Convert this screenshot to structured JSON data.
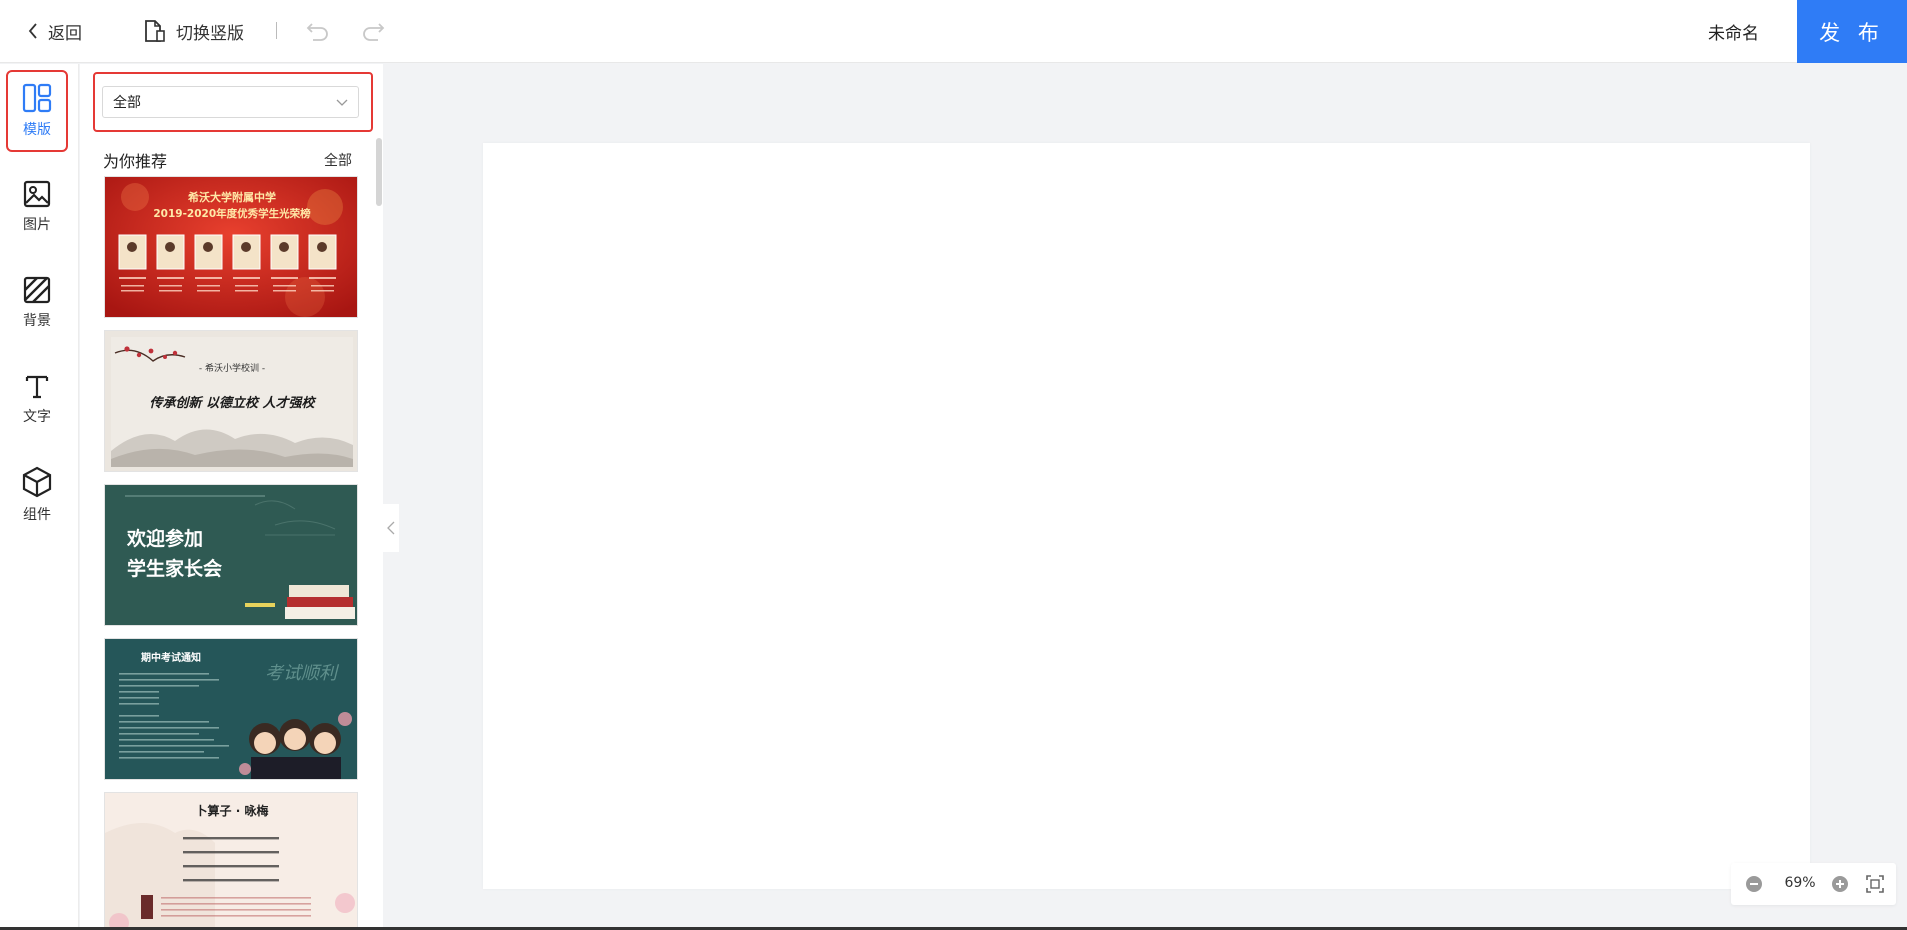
{
  "topbar": {
    "back_label": "返回",
    "switch_label": "切换竖版",
    "doc_name": "未命名",
    "publish_label": "发 布"
  },
  "sidebar": {
    "items": [
      {
        "label": "模版",
        "icon": "template-icon",
        "active": true
      },
      {
        "label": "图片",
        "icon": "image-icon",
        "active": false
      },
      {
        "label": "背景",
        "icon": "background-icon",
        "active": false
      },
      {
        "label": "文字",
        "icon": "text-icon",
        "active": false
      },
      {
        "label": "组件",
        "icon": "component-icon",
        "active": false
      }
    ]
  },
  "panel": {
    "category_value": "全部",
    "section_title": "为你推荐",
    "section_all": "全部",
    "templates": [
      {
        "title": "希沃大学附属中学",
        "subtitle": "2019-2020年度优秀学生光荣榜"
      },
      {
        "title": "- 希沃小学校训 -",
        "subtitle": "传承创新  以德立校  人才强校"
      },
      {
        "title": "欢迎参加",
        "subtitle": "学生家长会"
      },
      {
        "title": "期中考试通知",
        "subtitle": "考试顺利"
      },
      {
        "title": "卜算子 · 咏梅",
        "subtitle": ""
      }
    ]
  },
  "zoom": {
    "value": "69%"
  },
  "colors": {
    "accent": "#2f7cf6",
    "highlight": "#e53935"
  }
}
